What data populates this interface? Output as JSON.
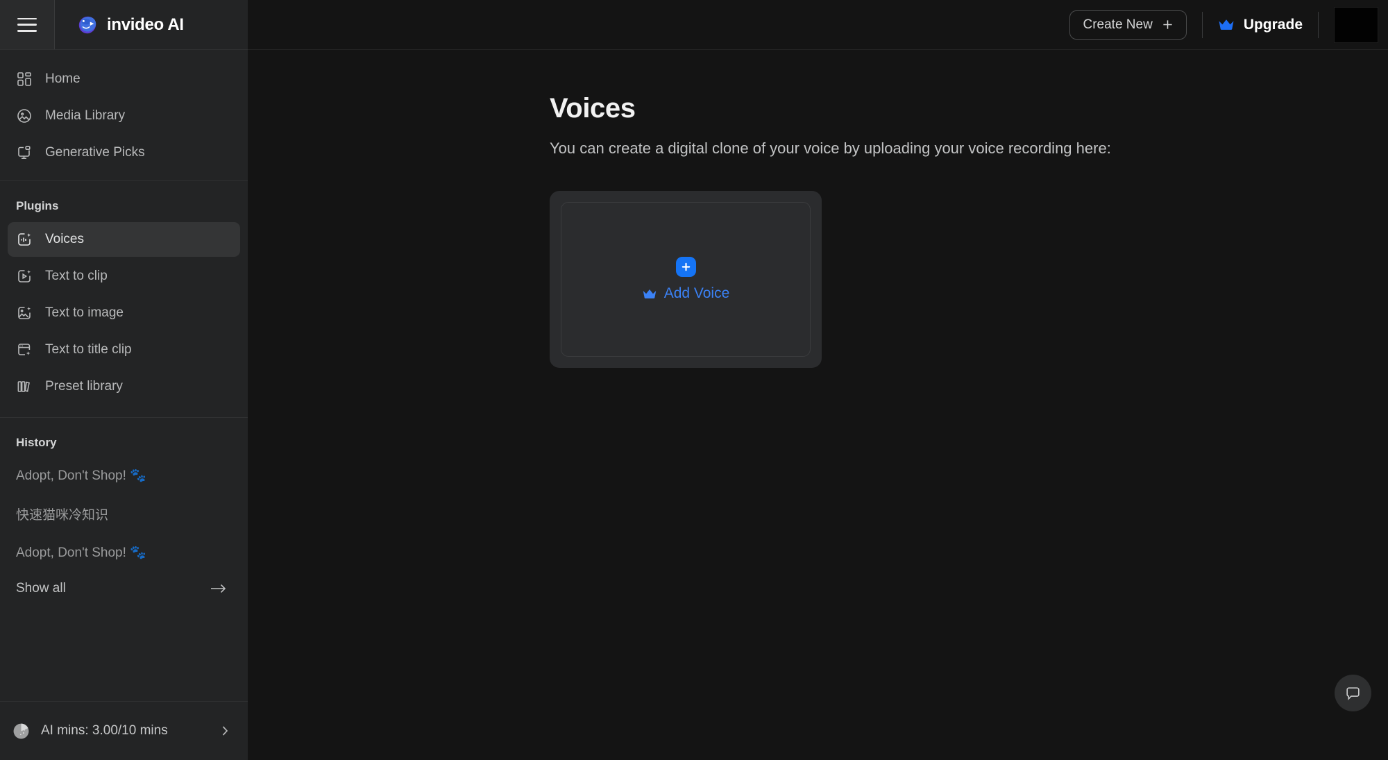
{
  "brand": {
    "name": "invideo AI",
    "logo_icon": "invideo-logo-icon"
  },
  "header": {
    "menu_icon": "hamburger-menu-icon",
    "create_new_label": "Create New",
    "create_new_icon": "plus-icon",
    "upgrade_label": "Upgrade",
    "upgrade_icon": "crown-icon",
    "avatar_name": "user-avatar"
  },
  "sidebar": {
    "nav": [
      {
        "label": "Home",
        "icon": "dashboard-grid-icon",
        "active": false
      },
      {
        "label": "Media Library",
        "icon": "image-circle-icon",
        "active": false
      },
      {
        "label": "Generative Picks",
        "icon": "monitor-sparkle-icon",
        "active": false
      }
    ],
    "plugins_title": "Plugins",
    "plugins": [
      {
        "label": "Voices",
        "icon": "voice-wave-sparkle-icon",
        "active": true
      },
      {
        "label": "Text to clip",
        "icon": "play-sparkle-icon",
        "active": false
      },
      {
        "label": "Text to image",
        "icon": "image-sparkle-icon",
        "active": false
      },
      {
        "label": "Text to title clip",
        "icon": "window-sparkle-icon",
        "active": false
      },
      {
        "label": "Preset library",
        "icon": "books-icon",
        "active": false
      }
    ],
    "history_title": "History",
    "history": [
      {
        "label": "Adopt, Don't Shop! 🐾"
      },
      {
        "label": "快速猫咪冷知识"
      },
      {
        "label": "Adopt, Don't Shop! 🐾"
      }
    ],
    "show_all_label": "Show all",
    "show_all_icon": "arrow-right-icon",
    "usage": {
      "label": "AI mins: 3.00/10 mins",
      "icon": "pie-chart-icon",
      "chevron_icon": "chevron-right-icon"
    }
  },
  "main": {
    "title": "Voices",
    "subtitle": "You can create a digital clone of your voice by uploading your voice recording here:",
    "add_voice_card": {
      "plus_icon": "plus-icon",
      "crown_icon": "crown-icon",
      "label": "Add Voice"
    },
    "chat_button_icon": "chat-bubble-icon"
  },
  "colors": {
    "accent_blue": "#1574f5",
    "link_blue": "#3b82f6",
    "sidebar_bg": "#232425",
    "main_bg": "#141414",
    "card_bg": "#2b2c2e",
    "active_item_bg": "#343536"
  }
}
